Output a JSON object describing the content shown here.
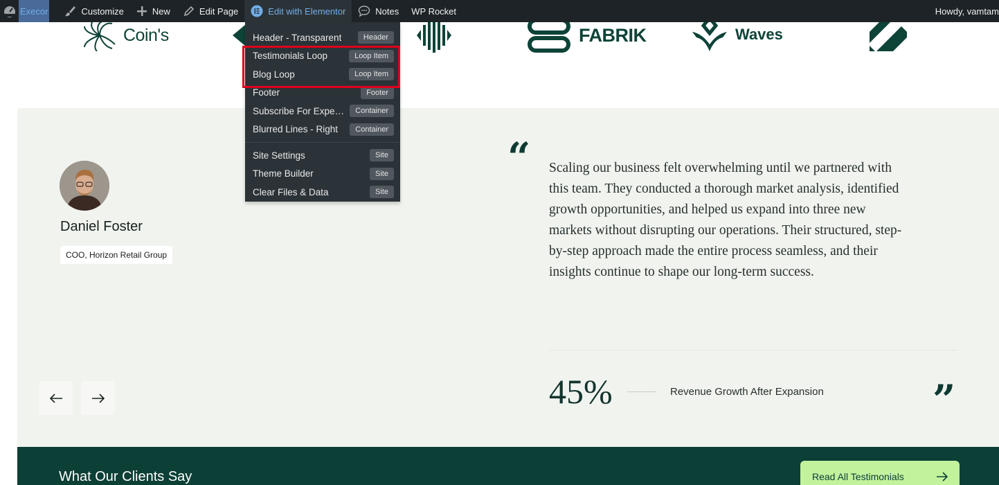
{
  "adminbar": {
    "site_name": "Execor",
    "customize": "Customize",
    "new": "New",
    "edit_page": "Edit Page",
    "edit_elementor": "Edit with Elementor",
    "notes": "Notes",
    "wp_rocket": "WP Rocket",
    "greeting": "Howdy, vamtam"
  },
  "dropdown": {
    "items": [
      {
        "label": "Header - Transparent",
        "badge": "Header"
      },
      {
        "label": "Testimonials Loop",
        "badge": "Loop Item"
      },
      {
        "label": "Blog Loop",
        "badge": "Loop Item"
      },
      {
        "label": "Footer",
        "badge": "Footer"
      },
      {
        "label": "Subscribe For Expert Insights",
        "badge": "Container"
      },
      {
        "label": "Blurred Lines - Right",
        "badge": "Container"
      }
    ],
    "site_items": [
      {
        "label": "Site Settings",
        "badge": "Site"
      },
      {
        "label": "Theme Builder",
        "badge": "Site"
      },
      {
        "label": "Clear Files & Data",
        "badge": "Site"
      }
    ]
  },
  "logos": {
    "coins": "Coin's",
    "fabrik": "FABRIK",
    "waves": "Waves"
  },
  "testimonial": {
    "name": "Daniel Foster",
    "role": "COO, Horizon Retail Group",
    "quote": "Scaling our business felt overwhelming until we partnered with this team. They conducted a thorough market analysis, identified growth opportunities, and helped us expand into three new markets without disrupting our operations. Their structured, step-by-step approach made the entire process seamless, and their insights continue to shape our long-term success.",
    "stat_value": "45%",
    "stat_label": "Revenue Growth After Expansion"
  },
  "footer_band": {
    "title": "What Our Clients Say",
    "button": "Read All Testimonials"
  },
  "colors": {
    "adminbar_bg": "#1d2327",
    "brand_green": "#0e4338",
    "card_bg": "#f1f3ef",
    "cta_green": "#c3f29d",
    "highlight_red": "#e0001a"
  }
}
